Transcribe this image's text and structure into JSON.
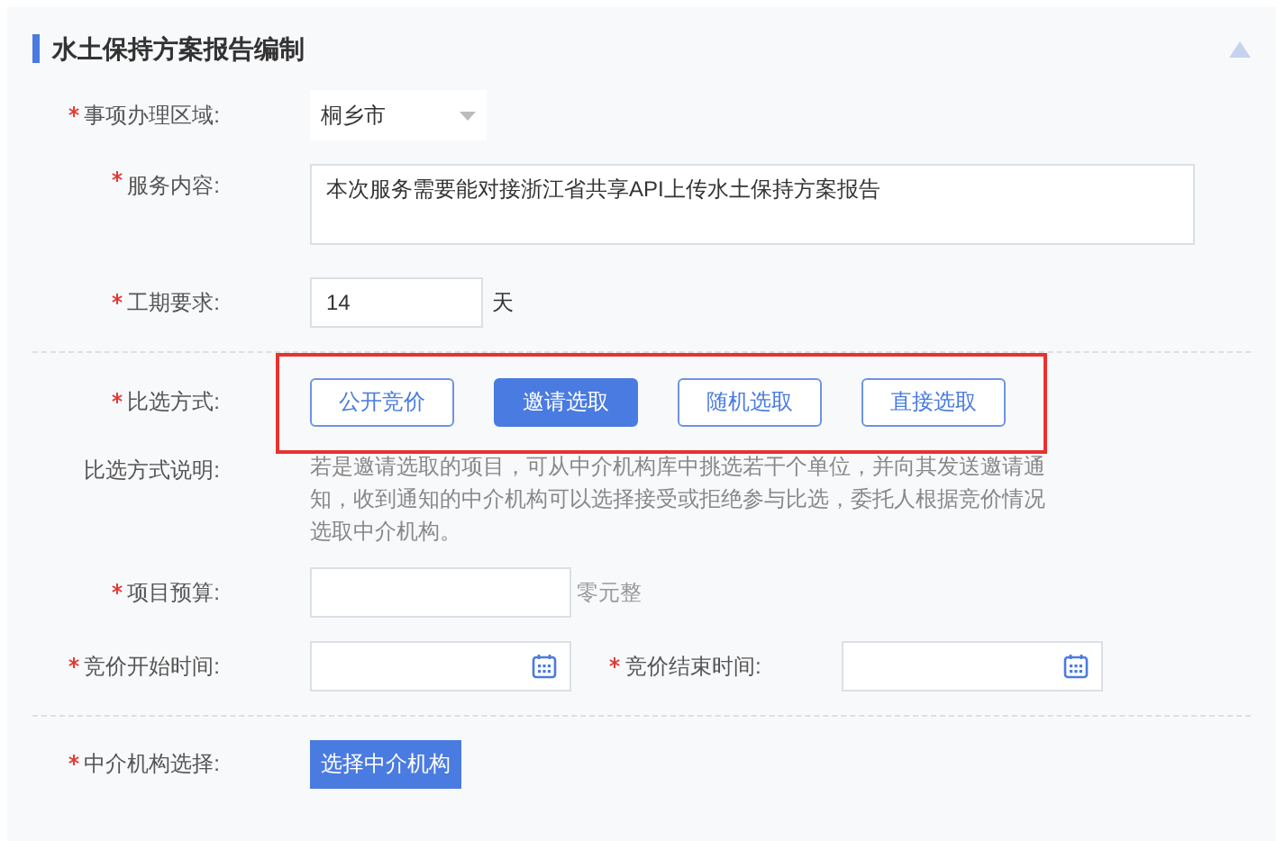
{
  "section": {
    "title": "水土保持方案报告编制",
    "expanded": true
  },
  "region": {
    "label": "事项办理区域:",
    "required": true,
    "value": "桐乡市"
  },
  "service": {
    "label": "服务内容:",
    "required": true,
    "value": "本次服务需要能对接浙江省共享API上传水土保持方案报告"
  },
  "period": {
    "label": "工期要求:",
    "required": true,
    "value": "14",
    "unit": "天"
  },
  "method": {
    "label": "比选方式:",
    "required": true,
    "options": [
      {
        "label": "公开竞价",
        "selected": false
      },
      {
        "label": "邀请选取",
        "selected": true
      },
      {
        "label": "随机选取",
        "selected": false
      },
      {
        "label": "直接选取",
        "selected": false
      }
    ]
  },
  "method_note": {
    "label": "比选方式说明:",
    "text": "若是邀请选取的项目，可从中介机构库中挑选若干个单位，并向其发送邀请通知，收到通知的中介机构可以选择接受或拒绝参与比选，委托人根据竞价情况选取中介机构。"
  },
  "budget": {
    "label": "项目预算:",
    "required": true,
    "suffix": "零元整"
  },
  "bid_start": {
    "label": "竞价开始时间:",
    "required": true
  },
  "bid_end": {
    "label": "竞价结束时间:",
    "required": true
  },
  "agency": {
    "label": "中介机构选择:",
    "required": true,
    "button": "选择中介机构"
  }
}
